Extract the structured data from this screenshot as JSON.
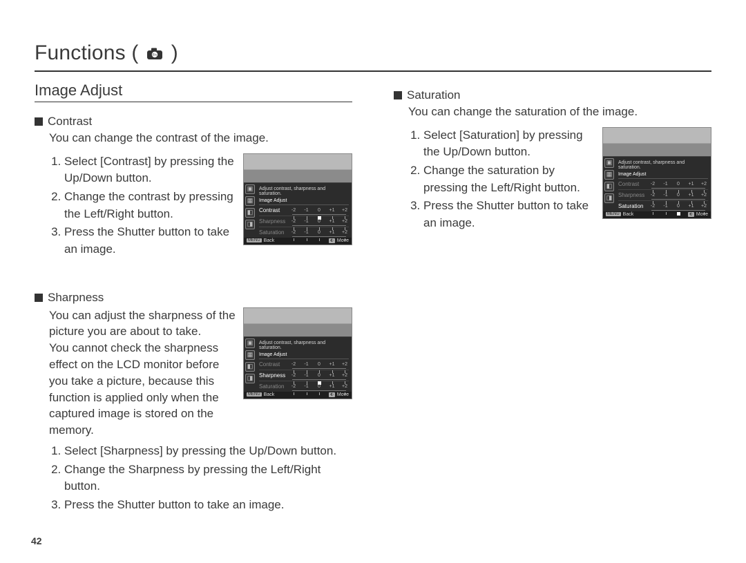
{
  "page_number": "42",
  "header": {
    "title_prefix": "Functions (",
    "title_suffix": " )",
    "icon": "camera-icon"
  },
  "col_left": {
    "section": "Image Adjust",
    "contrast": {
      "title": "Contrast",
      "desc": "You can change the contrast of the image.",
      "steps": [
        "Select [Contrast] by pressing the Up/Down button.",
        "Change the contrast by pressing the Left/Right button.",
        "Press the Shutter button to take an image."
      ]
    },
    "sharpness": {
      "title": "Sharpness",
      "desc1": "You can adjust the sharpness of the picture you are about to take.",
      "desc2": "You cannot check the sharpness effect on the LCD monitor before you take a picture, because this function is applied only when the captured image is stored on the memory.",
      "steps": [
        "Select [Sharpness] by pressing the Up/Down button.",
        "Change the Sharpness by pressing the Left/Right button.",
        "Press the Shutter button to take an image."
      ]
    }
  },
  "col_right": {
    "saturation": {
      "title": "Saturation",
      "desc": "You can change the saturation of the image.",
      "steps": [
        "Select [Saturation] by pressing the Up/Down button.",
        "Change the saturation by pressing the Left/Right button.",
        "Press the Shutter button to take an image."
      ]
    }
  },
  "lcd": {
    "hint": "Adjust contrast, sharpness and saturation.",
    "menu_title": "Image Adjust",
    "contrast_label": "Contrast",
    "sharpness_label": "Sharpness",
    "saturation_label": "Saturation",
    "ticks": [
      "-2",
      "-1",
      "0",
      "+1",
      "+2"
    ],
    "back": "Back",
    "move": "Move",
    "back_chip": "MENU",
    "move_chip": "✥"
  }
}
